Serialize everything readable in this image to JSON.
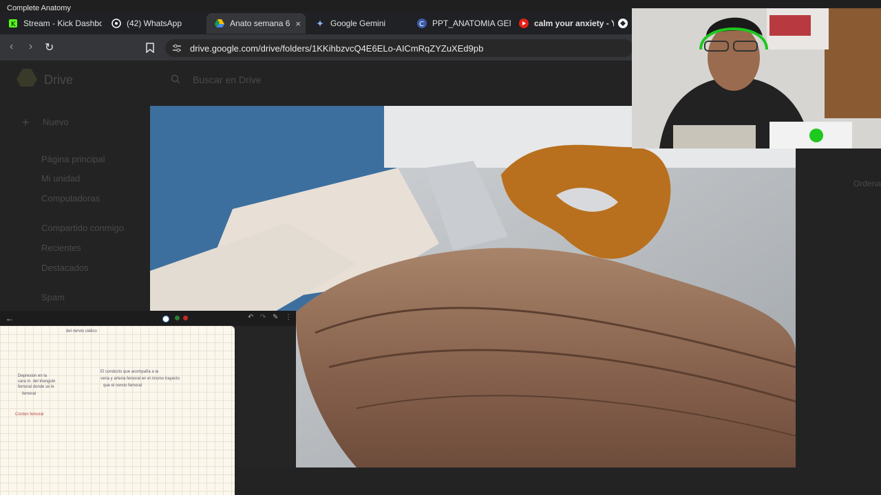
{
  "window": {
    "title": "Complete Anatomy"
  },
  "tabs": [
    {
      "label": "Stream - Kick Dashbo",
      "icon": "kick-icon",
      "active": false
    },
    {
      "label": "(42) WhatsApp",
      "icon": "whatsapp-icon",
      "active": false
    },
    {
      "label": "Anato semana 6",
      "icon": "google-drive-icon",
      "active": true,
      "close": "×"
    },
    {
      "label": "Google Gemini",
      "icon": "gemini-icon",
      "active": false
    },
    {
      "label": "PPT_ANATOMIA GEN",
      "icon": "c-site-icon",
      "active": false
    },
    {
      "label": "calm your anxiety - Y",
      "icon": "youtube-icon",
      "active": false
    }
  ],
  "toolbar": {
    "back": "‹",
    "forward": "›",
    "reload": "↻",
    "url": "drive.google.com/drive/folders/1KKihbzvcQ4E6ELo-AICmRqZYZuXEd9pb"
  },
  "drive": {
    "logo_text": "Drive",
    "search_placeholder": "Buscar en Drive",
    "new_button": "Nuevo",
    "sidebar": [
      "Página principal",
      "Mi unidad",
      "Computadoras",
      "Compartido conmigo",
      "Recientes",
      "Destacados",
      "Spam"
    ],
    "right_label": "Ordenar"
  },
  "notes": {
    "lines": [
      {
        "text": "del nervio ciático",
        "color": "#556"
      },
      {
        "text": "Depresion en la",
        "color": "#556"
      },
      {
        "text": "cara m. del triangulo",
        "color": "#556"
      },
      {
        "text": "femoral donde se le",
        "color": "#556"
      },
      {
        "text": "femoral",
        "color": "#556"
      },
      {
        "text": "El conducto que acompaña a la",
        "color": "#556"
      },
      {
        "text": "vena y arteria femoral en el mismo trayecto",
        "color": "#556"
      },
      {
        "text": "que el nervio femoral",
        "color": "#556"
      },
      {
        "text": "Cordon femoral",
        "color": "#b44"
      }
    ]
  },
  "colors": {
    "tab_bar": "#202124",
    "toolbar": "#35363a",
    "accent_green": "#21c721"
  }
}
